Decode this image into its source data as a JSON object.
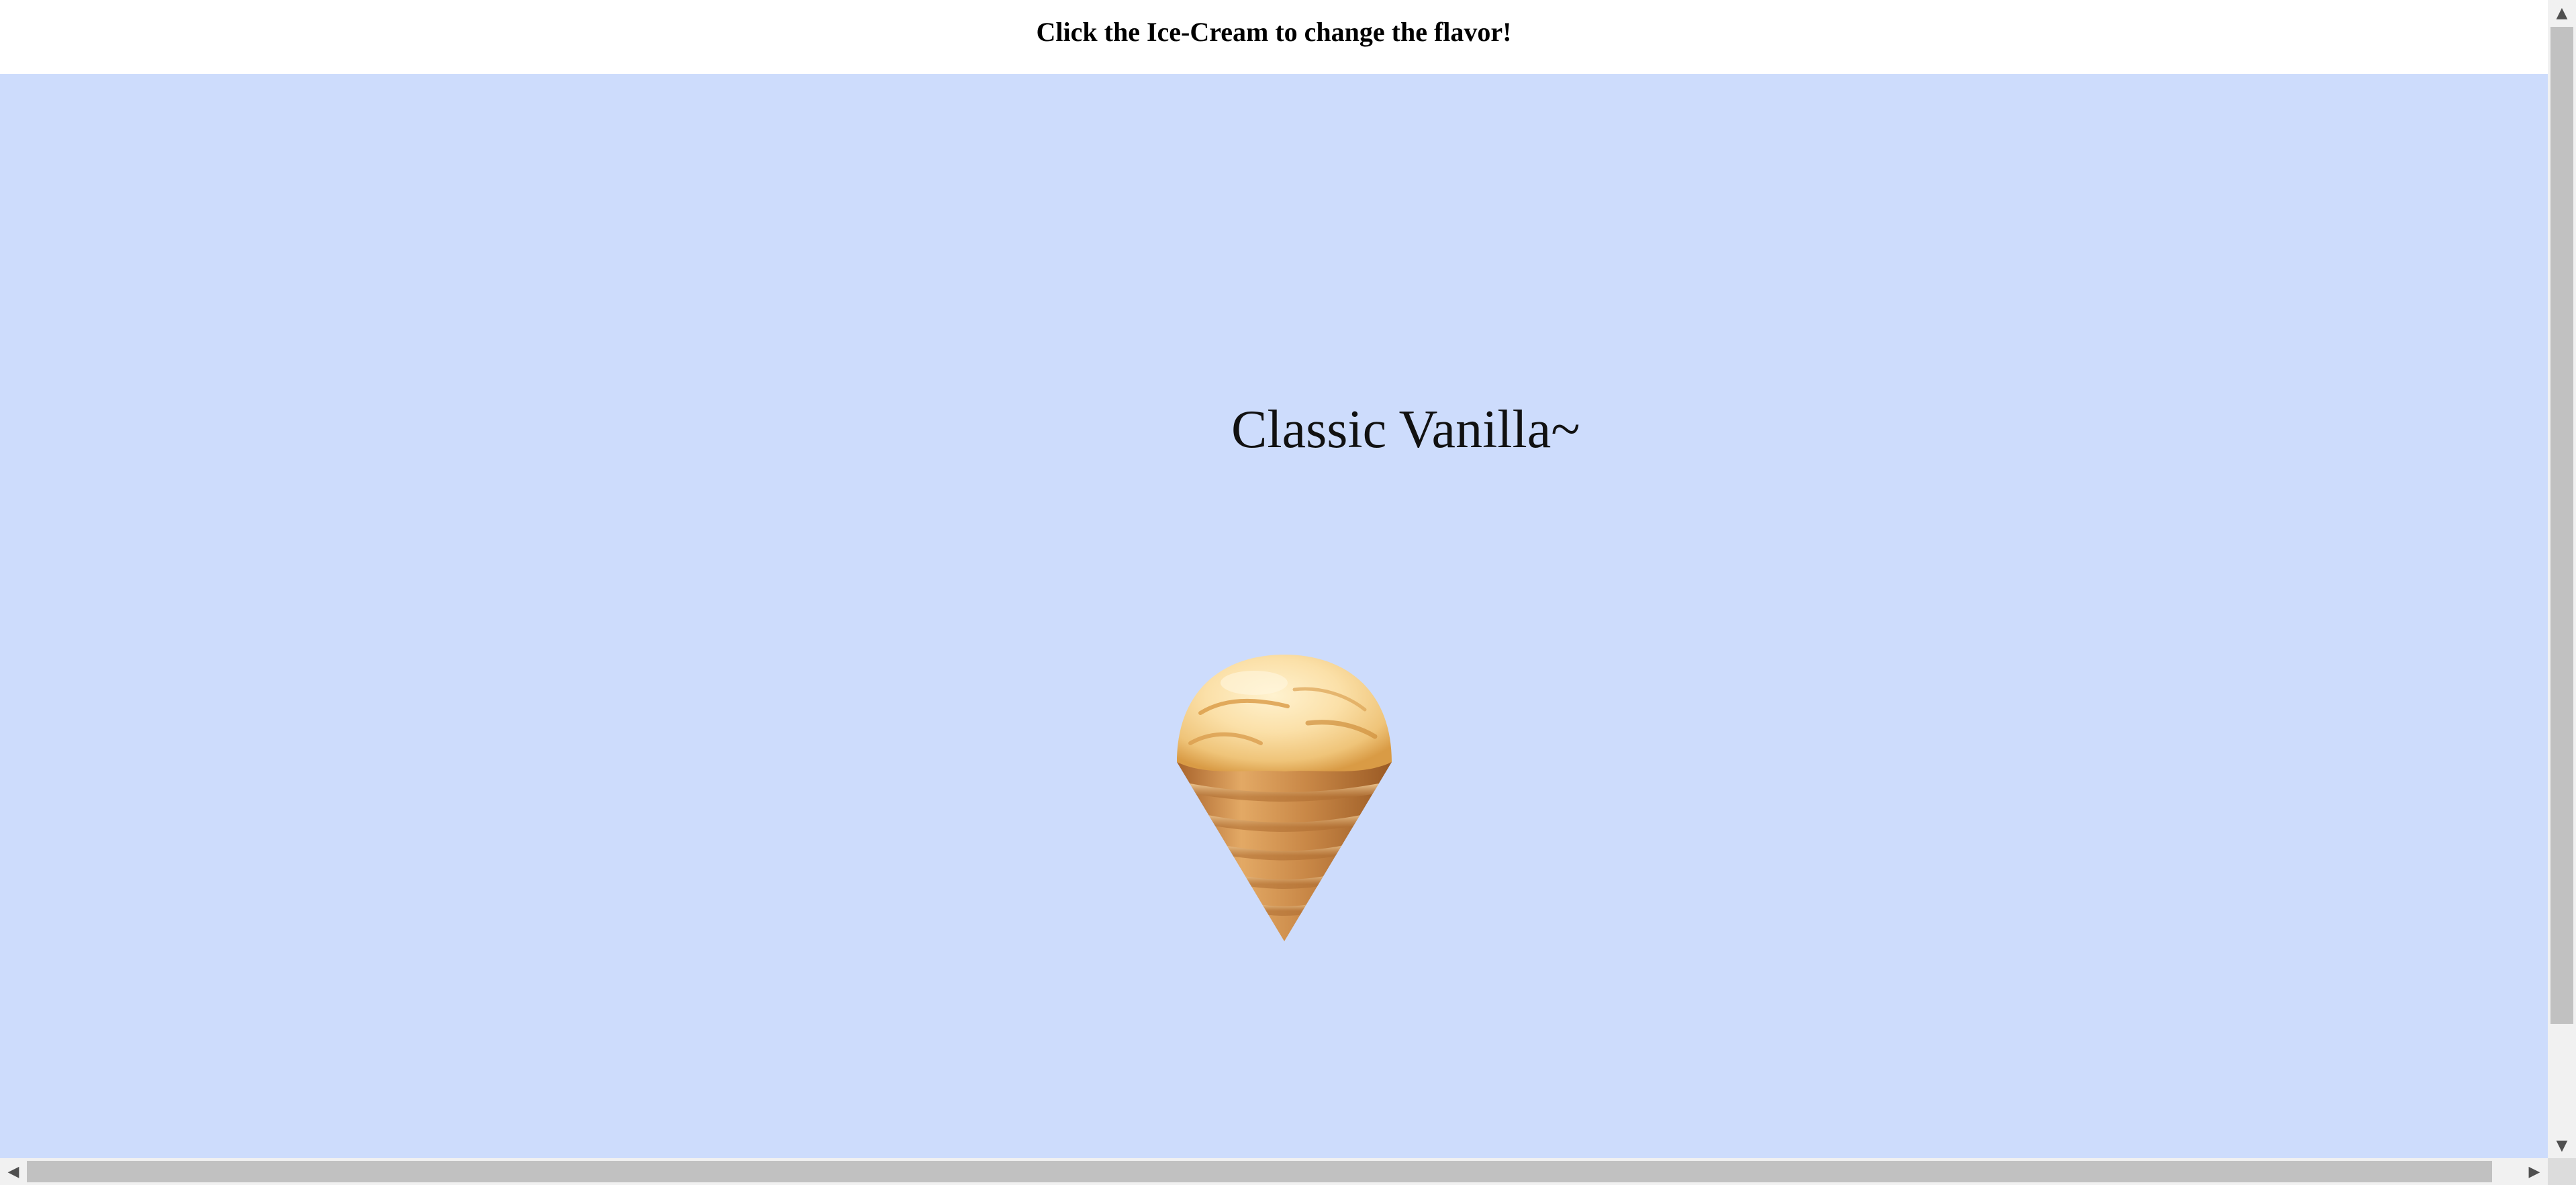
{
  "header": {
    "instruction": "Click the Ice-Cream to change the flavor!"
  },
  "flavor": {
    "name": "Classic Vanilla~"
  },
  "icons": {
    "icecream": "ice-cream-cone-icon",
    "scroll_up": "arrow-up-icon",
    "scroll_down": "arrow-down-icon",
    "scroll_left": "arrow-left-icon",
    "scroll_right": "arrow-right-icon"
  },
  "colors": {
    "background": "#cddcfc",
    "header_background": "#ffffff",
    "scoop": "#f7d79a",
    "cone": "#c98b4a"
  }
}
